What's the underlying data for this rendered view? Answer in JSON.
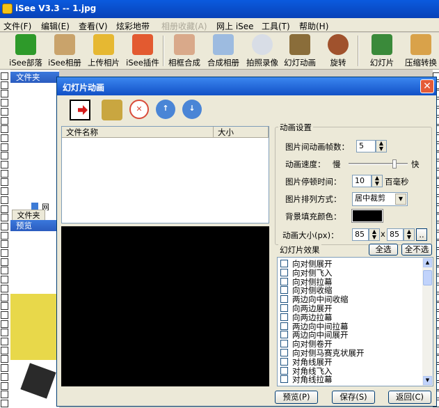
{
  "app": {
    "title": "iSee V3.3 -- 1.jpg"
  },
  "menu": [
    "文件(F)",
    "编辑(E)",
    "查看(V)",
    "炫彩地带",
    "相册收藏(A)",
    "网上 iSee",
    "工具(T)",
    "帮助(H)"
  ],
  "toolbar": [
    "iSee部落",
    "iSee相册",
    "上传相片",
    "iSee插件",
    "相框合成",
    "合成相册",
    "拍照录像",
    "幻灯动画",
    "旋转",
    "幻灯片",
    "压缩转换"
  ],
  "left": {
    "folder_tab": "文件夹",
    "tree_item": "网",
    "folder_tab2": "文件夹",
    "preview_header": "预览"
  },
  "dialog": {
    "title": "幻灯片动画",
    "file_list": {
      "col_name": "文件名称",
      "col_size": "大小"
    },
    "anim": {
      "group_label": "动画设置",
      "frames_label": "图片间动画帧数：",
      "frames_value": "5",
      "speed_label": "动画速度：",
      "slow": "慢",
      "fast": "快",
      "speed_level": 0.8,
      "pause_label": "图片停顿时间：",
      "pause_value": "10",
      "pause_unit": "百毫秒",
      "arrange_label": "图片排列方式：",
      "arrange_value": "居中裁剪",
      "bg_label": "背景填充颜色：",
      "bg_color": "#000000",
      "size_label": "动画大小(px)：",
      "width": "85",
      "x": "x",
      "height": "85",
      "more": ".."
    },
    "effects": {
      "group_label": "幻灯片效果",
      "select_all": "全选",
      "select_none": "全不选",
      "items": [
        "向对侧展开",
        "向对侧飞入",
        "向对侧拉幕",
        "向对侧收缩",
        "两边向中间收缩",
        "向两边展开",
        "向两边拉幕",
        "两边向中间拉幕",
        "两边向中间展开",
        "向对侧卷开",
        "向对侧马赛克状展开",
        "对角线展开",
        "对角线飞入",
        "对角线拉幕"
      ]
    },
    "buttons": {
      "preview": "预览(P)",
      "save": "保存(S)",
      "back": "返回(C)"
    }
  }
}
